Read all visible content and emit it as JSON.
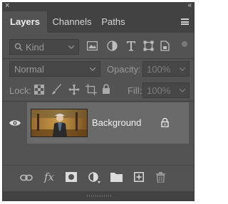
{
  "panel": {
    "tabs": [
      {
        "label": "Layers",
        "active": true
      },
      {
        "label": "Channels",
        "active": false
      },
      {
        "label": "Paths",
        "active": false
      }
    ]
  },
  "filter": {
    "kind_label": "Kind",
    "filter_icons": [
      "image-filter-icon",
      "adjustment-filter-icon",
      "type-filter-icon",
      "shape-filter-icon",
      "smart-object-filter-icon"
    ]
  },
  "blend": {
    "mode": "Normal",
    "opacity_label": "Opacity:",
    "opacity_value": "100%"
  },
  "lock": {
    "label": "Lock:",
    "fill_label": "Fill:",
    "fill_value": "100%"
  },
  "layers": [
    {
      "name": "Background",
      "visible": true,
      "locked": true
    }
  ],
  "footer_icons": [
    "link-layers-icon",
    "fx-icon",
    "add-mask-icon",
    "adjustment-layer-icon",
    "new-group-icon",
    "new-layer-icon",
    "delete-layer-icon"
  ],
  "colors": {
    "panel_bg": "#535353",
    "tab_bar_bg": "#424242",
    "selected_layer_bg": "#6a6a6a"
  }
}
